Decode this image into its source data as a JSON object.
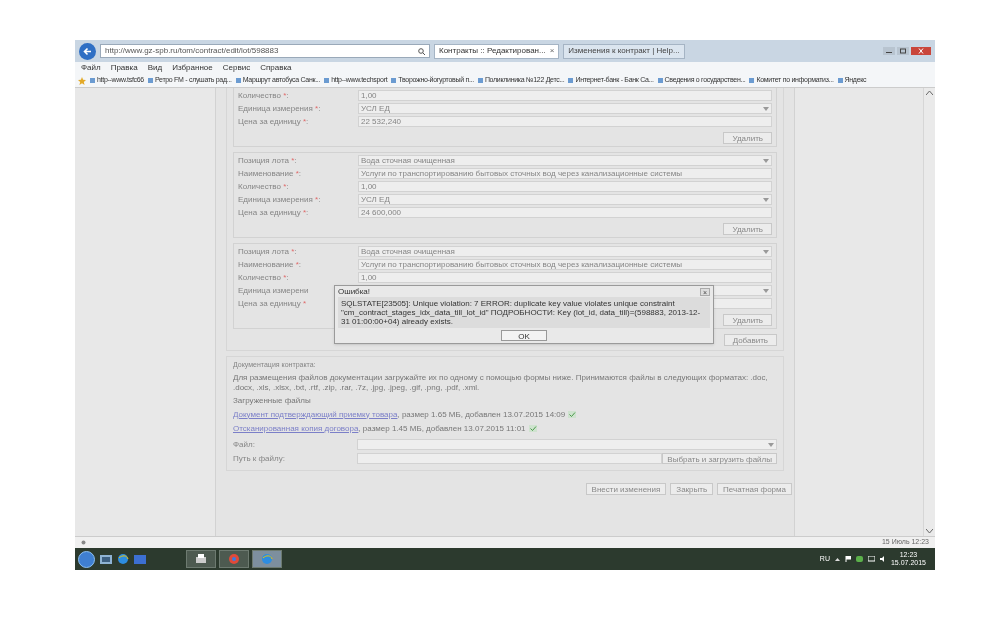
{
  "browser": {
    "address": "http://www.gz-spb.ru/tom/contract/edit/lot/598883",
    "tabs": [
      {
        "label": "Контракты :: Редактирован...",
        "selected": true,
        "close": "×"
      },
      {
        "label": "Изменения к контракт | Help...",
        "selected": false
      }
    ],
    "menu": [
      "Файл",
      "Правка",
      "Вид",
      "Избранное",
      "Сервис",
      "Справка"
    ],
    "bookmarks": [
      "http--www.tsfc66",
      "Ретро FM - слушать рад...",
      "Маршрут автобуса Санк...",
      "http--www.techsport",
      "Творожно-йогуртовый п...",
      "Поликлиника №122 Детс...",
      "Интернет-банк - Банк Са...",
      "Сведения о государствен...",
      "Комитет по информатиз...",
      "Яндекс"
    ]
  },
  "lots": [
    {
      "fields": [
        {
          "label": "Количество ",
          "mark": "*",
          "tail": ":",
          "kind": "text",
          "value": "1,00"
        },
        {
          "label": "Единица измерения ",
          "mark": "*",
          "tail": ":",
          "kind": "select",
          "value": "УСЛ ЕД"
        },
        {
          "label": "Цена за единицу ",
          "mark": "*",
          "tail": ":",
          "kind": "text",
          "value": "22 532,240"
        }
      ],
      "delete": "Удалить"
    },
    {
      "fields": [
        {
          "label": "Позиция лота ",
          "mark": "*",
          "tail": ":",
          "kind": "select",
          "value": "Вода сточная очищенная"
        },
        {
          "label": "Наименование ",
          "mark": "*",
          "tail": ":",
          "kind": "text",
          "value": "Услуги по транспортированию бытовых сточных вод через канализационные системы"
        },
        {
          "label": "Количество ",
          "mark": "*",
          "tail": ":",
          "kind": "text",
          "value": "1,00"
        },
        {
          "label": "Единица измерения ",
          "mark": "*",
          "tail": ":",
          "kind": "select",
          "value": "УСЛ ЕД"
        },
        {
          "label": "Цена за единицу ",
          "mark": "*",
          "tail": ":",
          "kind": "text",
          "value": "24 600,000"
        }
      ],
      "delete": "Удалить"
    },
    {
      "fields": [
        {
          "label": "Позиция лота ",
          "mark": "*",
          "tail": ":",
          "kind": "select",
          "value": "Вода сточная очищенная"
        },
        {
          "label": "Наименование ",
          "mark": "*",
          "tail": ":",
          "kind": "text",
          "value": "Услуги по транспортированию бытовых сточных вод через канализационные системы"
        },
        {
          "label": "Количество ",
          "mark": "*",
          "tail": ":",
          "kind": "text",
          "value": "1,00"
        },
        {
          "label": "Единица измерени",
          "kind": "select"
        },
        {
          "label": "Цена за единицу ",
          "mark": "*",
          "kind": "text"
        }
      ],
      "delete": "Удалить"
    }
  ],
  "add_button": "Добавить",
  "dialog": {
    "title": "Ошибка!",
    "close": "×",
    "message": "SQLSTATE[23505]: Unique violation: 7 ERROR: duplicate key value violates unique constraint \"cm_contract_stages_idx_data_till_lot_id\" ПОДРОБНОСТИ: Key (lot_id, data_till)=(598883, 2013-12-31 01:00:00+04) already exists.",
    "button": "OK"
  },
  "documents": {
    "legend": "Документация контракта:",
    "info": "Для размещения файлов документации загружайте их по одному с помощью формы ниже. Принимаются файлы в следующих форматах: .doc, .docx, .xls, .xlsx, .txt, .rtf, .zip, .rar, .7z, .jpg, .jpeg, .gif, .png, .pdf, .xml.",
    "uploaded_heading": "Загруженные файлы",
    "files": [
      {
        "name": "Документ подтверждающий приемку товара",
        "details": ", размер 1.65 МБ, добавлен 13.07.2015 14:09"
      },
      {
        "name": "Отсканированная копия договора",
        "details": ", размер 1.45 МБ, добавлен 13.07.2015 11:01"
      }
    ],
    "file_label": "Файл:",
    "path_label": "Путь к файлу:",
    "upload_button": "Выбрать и загрузить файлы"
  },
  "actions": [
    "Внести изменения",
    "Закрыть",
    "Печатная форма"
  ],
  "status_bar": {
    "time": "15 Июль 12:23"
  },
  "taskbar": {
    "language": "RU",
    "time": "12:23",
    "date": "15.07.2015"
  }
}
